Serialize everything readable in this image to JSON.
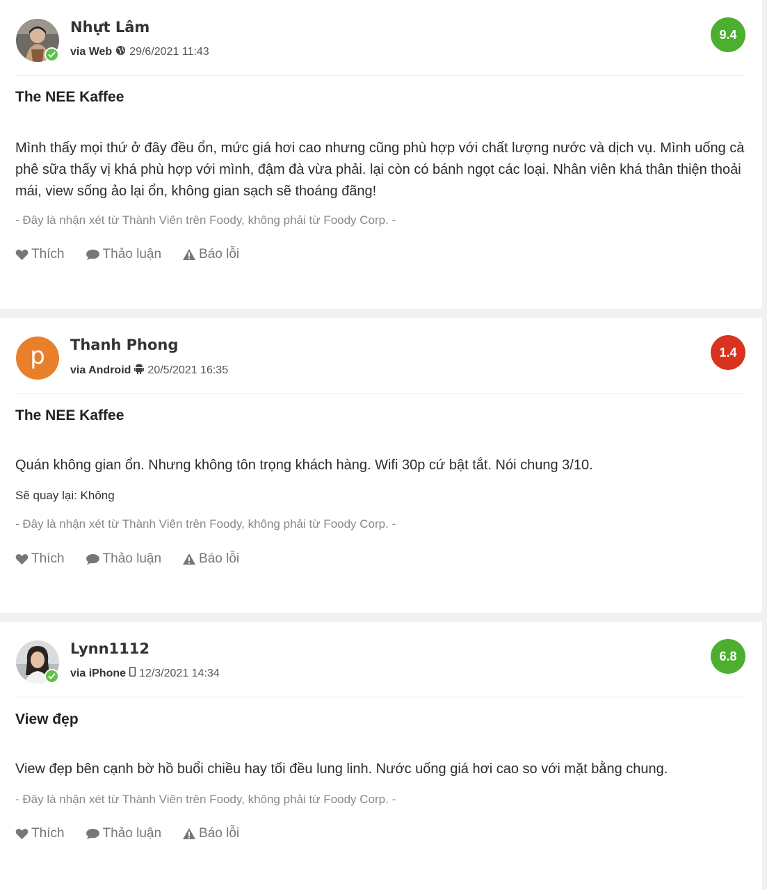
{
  "reviews": [
    {
      "name": "Nhựt Lâm",
      "via": "via Web",
      "device_icon": "globe-icon",
      "datetime": "29/6/2021 11:43",
      "score": "9.4",
      "score_color": "#4caf2f",
      "verified": true,
      "title": "The NEE Kaffee",
      "body": "Mình thấy mọi thứ ở đây đều ổn, mức giá hơi cao nhưng cũng phù hợp với chất lượng nước và dịch vụ. Mình uống cà phê sữa thấy vị khá phù hợp với mình, đậm đà vừa phải. lại còn có bánh ngọt các loại. Nhân viên khá thân thiện thoải mái, view sống ảo lại ổn, không gian sạch sẽ thoáng đãng!",
      "disclaimer": "- Đây là nhận xét từ Thành Viên trên Foody, không phải từ Foody Corp. -",
      "actions": {
        "like": "Thích",
        "discuss": "Thảo luận",
        "report": "Báo lỗi"
      }
    },
    {
      "name": "Thanh Phong",
      "via": "via Android",
      "device_icon": "android-icon",
      "datetime": "20/5/2021 16:35",
      "score": "1.4",
      "score_color": "#d9321e",
      "avatar_letter": "p",
      "avatar_color": "#e8802b",
      "title": "The NEE Kaffee",
      "body": "Quán không gian ổn. Nhưng không tôn trọng khách hàng. Wifi 30p cứ bật tắt. Nói chung 3/10.",
      "revisit": "Sẽ quay lại: Không",
      "disclaimer": "- Đây là nhận xét từ Thành Viên trên Foody, không phải từ Foody Corp. -",
      "actions": {
        "like": "Thích",
        "discuss": "Thảo luận",
        "report": "Báo lỗi"
      }
    },
    {
      "name": "Lynn1112",
      "via": "via iPhone",
      "device_icon": "phone-icon",
      "datetime": "12/3/2021 14:34",
      "score": "6.8",
      "score_color": "#4caf2f",
      "verified": true,
      "title": "View đẹp",
      "body": "View đẹp bên cạnh bờ hồ buổi chiều hay tối đều lung linh. Nước uống giá hơi cao so với mặt bằng chung.",
      "disclaimer": "- Đây là nhận xét từ Thành Viên trên Foody, không phải từ Foody Corp. -",
      "actions": {
        "like": "Thích",
        "discuss": "Thảo luận",
        "report": "Báo lỗi"
      }
    }
  ]
}
